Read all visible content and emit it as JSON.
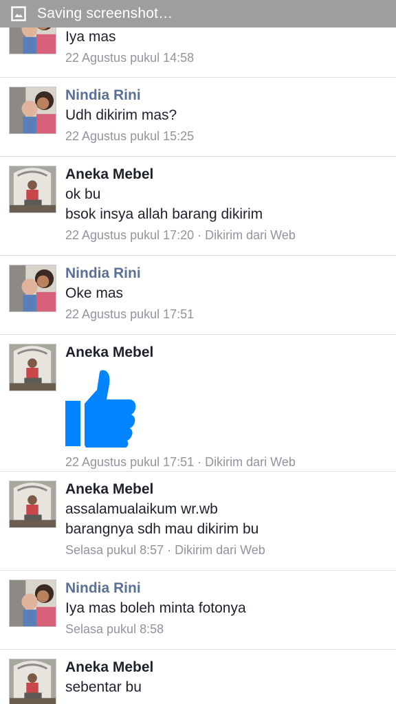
{
  "statusbar": {
    "text": "Saving screenshot…",
    "icon": "image-icon"
  },
  "colors": {
    "statusbar": "#9e9e9e",
    "nindia_name": "#5b7096",
    "meta": "#90949c",
    "like": "#0084ff"
  },
  "messages": [
    {
      "sender": "",
      "lines": [
        "Iya mas"
      ],
      "time": "22 Agustus pukul 14:58",
      "via": ""
    },
    {
      "sender": "Nindia Rini",
      "lines": [
        "Udh dikirim mas?"
      ],
      "time": "22 Agustus pukul 15:25",
      "via": ""
    },
    {
      "sender": "Aneka Mebel",
      "lines": [
        "ok bu",
        "bsok insya allah barang dikirim"
      ],
      "time": "22 Agustus pukul 17:20",
      "via": "Dikirim dari Web"
    },
    {
      "sender": "Nindia Rini",
      "lines": [
        "Oke mas"
      ],
      "time": "22 Agustus pukul 17:51",
      "via": ""
    },
    {
      "sender": "Aneka Mebel",
      "lines": [],
      "sticker": "thumbs-up-icon",
      "time": "22 Agustus pukul 17:51",
      "via": "Dikirim dari Web"
    },
    {
      "sender": "Aneka Mebel",
      "lines": [
        "assalamualaikum wr.wb",
        "barangnya sdh mau dikirim bu"
      ],
      "time": "Selasa pukul 8:57",
      "via": "Dikirim dari Web"
    },
    {
      "sender": "Nindia Rini",
      "lines": [
        "Iya mas boleh minta fotonya"
      ],
      "time": "Selasa pukul 8:58",
      "via": ""
    },
    {
      "sender": "Aneka Mebel",
      "lines": [
        "sebentar bu"
      ],
      "time": "",
      "via": ""
    }
  ]
}
